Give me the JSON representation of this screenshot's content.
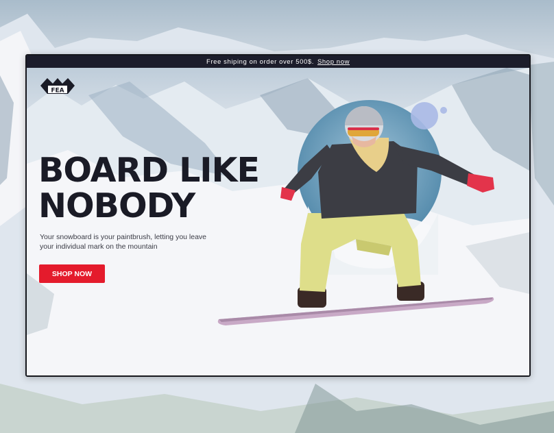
{
  "announcement": {
    "text": "Free shiping on order over 500$.",
    "link": "Shop now"
  },
  "logo": {
    "text": "FEA"
  },
  "hero": {
    "headline_line1": "BOARD LIKE",
    "headline_line2": "NOBODY",
    "subtext": "Your snowboard is your paintbrush, letting you leave your individual mark on the mountain",
    "cta_label": "SHOP NOW"
  },
  "colors": {
    "topbar": "#1c1d2b",
    "headline": "#1a1b26",
    "cta": "#e41b2c",
    "jacket": "#3c3d44",
    "pants": "#dede8a",
    "gloves": "#e3344b"
  }
}
